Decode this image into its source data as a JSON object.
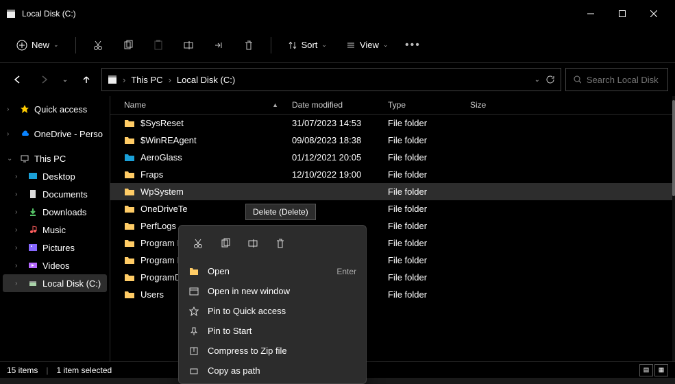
{
  "window": {
    "title": "Local Disk  (C:)"
  },
  "toolbar": {
    "new": "New",
    "sort": "Sort",
    "view": "View"
  },
  "address": {
    "segments": [
      "This PC",
      "Local Disk  (C:)"
    ]
  },
  "search": {
    "placeholder": "Search Local Disk  ..."
  },
  "sidebar": [
    {
      "label": "Quick access",
      "icon": "star",
      "color": "#ffcc00",
      "chev": "›"
    },
    {
      "label": "OneDrive - Perso",
      "icon": "cloud",
      "color": "#0a84ff",
      "chev": "›"
    },
    {
      "label": "This PC",
      "icon": "pc",
      "color": "#ccc",
      "chev": "⌄"
    },
    {
      "label": "Desktop",
      "icon": "desktop",
      "color": "#1aa0d8",
      "chev": "›",
      "indent": true
    },
    {
      "label": "Documents",
      "icon": "doc",
      "color": "#ddd",
      "chev": "›",
      "indent": true
    },
    {
      "label": "Downloads",
      "icon": "download",
      "color": "#56c568",
      "chev": "›",
      "indent": true
    },
    {
      "label": "Music",
      "icon": "music",
      "color": "#ff5e5e",
      "chev": "›",
      "indent": true
    },
    {
      "label": "Pictures",
      "icon": "pictures",
      "color": "#8768ff",
      "chev": "›",
      "indent": true
    },
    {
      "label": "Videos",
      "icon": "video",
      "color": "#b568ff",
      "chev": "›",
      "indent": true
    },
    {
      "label": "Local Disk  (C:)",
      "icon": "disk",
      "color": "#aad4aa",
      "chev": "›",
      "indent": true,
      "selected": true
    }
  ],
  "columns": {
    "name": "Name",
    "date": "Date modified",
    "type": "Type",
    "size": "Size"
  },
  "rows": [
    {
      "name": "$SysReset",
      "date": "31/07/2023 14:53",
      "type": "File folder"
    },
    {
      "name": "$WinREAgent",
      "date": "09/08/2023 18:38",
      "type": "File folder"
    },
    {
      "name": "AeroGlass",
      "date": "01/12/2021 20:05",
      "type": "File folder",
      "iconColor": "#1aa0d8"
    },
    {
      "name": "Fraps",
      "date": "12/10/2022 19:00",
      "type": "File folder"
    },
    {
      "name": "WpSystem",
      "date": "",
      "type": "File folder",
      "selected": true
    },
    {
      "name": "OneDriveTe",
      "date": "",
      "type": "File folder"
    },
    {
      "name": "PerfLogs",
      "date": "",
      "type": "File folder"
    },
    {
      "name": "Program File",
      "date": "",
      "type": "File folder"
    },
    {
      "name": "Program File",
      "date": "",
      "type": "File folder"
    },
    {
      "name": "ProgramDat",
      "date": "",
      "type": "File folder"
    },
    {
      "name": "Users",
      "date": "",
      "type": "File folder"
    }
  ],
  "status": {
    "items": "15 items",
    "selected": "1 item selected"
  },
  "tooltip": "Delete (Delete)",
  "context": {
    "items": [
      {
        "label": "Open",
        "shortcut": "Enter",
        "icon": "folder"
      },
      {
        "label": "Open in new window",
        "icon": "window"
      },
      {
        "label": "Pin to Quick access",
        "icon": "pin-star"
      },
      {
        "label": "Pin to Start",
        "icon": "pin"
      },
      {
        "label": "Compress to Zip file",
        "icon": "zip"
      },
      {
        "label": "Copy as path",
        "icon": "path"
      }
    ]
  }
}
